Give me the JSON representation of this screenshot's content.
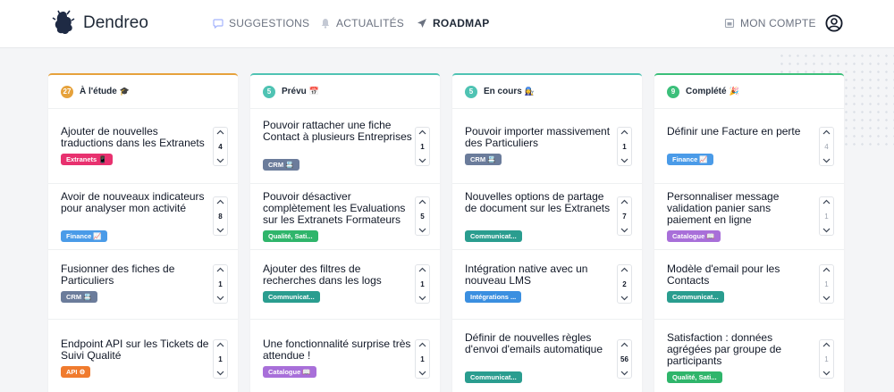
{
  "header": {
    "brand": "Dendreo",
    "nav": [
      {
        "label": "SUGGESTIONS",
        "icon": "chat-bubble-icon"
      },
      {
        "label": "ACTUALITÉS",
        "icon": "bell-icon"
      },
      {
        "label": "ROADMAP",
        "icon": "rocket-icon",
        "active": true
      }
    ],
    "account": {
      "label": "MON COMPTE",
      "icon": "account-icon"
    },
    "user_icon": "user-circle-icon"
  },
  "colors": {
    "etude": "#e6a23c",
    "prevu": "#4fc3b3",
    "encours": "#4fc3b3",
    "complete": "#3bbf7a",
    "tag_extranets": "#e8316f",
    "tag_finance": "#4a9be8",
    "tag_crm": "#6b7c9b",
    "tag_api": "#f07b2e",
    "tag_qualite": "#2fb56b",
    "tag_communication": "#2a9d8f",
    "tag_catalogue": "#a86fd9",
    "tag_integrations": "#3b8fe0"
  },
  "columns": [
    {
      "count": "27",
      "title": "À l'étude",
      "emoji": "🎓",
      "cards": [
        {
          "title": "Ajouter de nouvelles traductions dans les Extranets",
          "tag": "Extranets 📱",
          "votes": "4"
        },
        {
          "title": "Avoir de nouveaux indicateurs pour analyser mon activité",
          "tag": "Finance 📈",
          "votes": "8"
        },
        {
          "title": "Fusionner des fiches de Particuliers",
          "tag": "CRM 📇",
          "votes": "1"
        },
        {
          "title": "Endpoint API sur les Tickets de Suivi Qualité",
          "tag": "API ⚙",
          "votes": "1"
        }
      ]
    },
    {
      "count": "5",
      "title": "Prévu",
      "emoji": "📅",
      "cards": [
        {
          "title": "Pouvoir rattacher une fiche Contact à plusieurs Entreprises",
          "tag": "CRM 📇",
          "votes": "1"
        },
        {
          "title": "Pouvoir désactiver complètement les Evaluations sur les Extranets Formateurs",
          "tag": "Qualité, Sati...",
          "votes": "5"
        },
        {
          "title": "Ajouter des filtres de recherches dans les logs",
          "tag": "Communicat...",
          "votes": "1"
        },
        {
          "title": "Une fonctionnalité surprise très attendue !",
          "tag": "Catalogue 📖",
          "votes": "1"
        }
      ]
    },
    {
      "count": "5",
      "title": "En cours",
      "emoji": "👩‍🔧",
      "cards": [
        {
          "title": "Pouvoir importer massivement des Particuliers",
          "tag": "CRM 📇",
          "votes": "1"
        },
        {
          "title": "Nouvelles options de partage de document sur les Extranets",
          "tag": "Communicat...",
          "votes": "7"
        },
        {
          "title": "Intégration native avec un nouveau LMS",
          "tag": "Intégrations ...",
          "votes": "2"
        },
        {
          "title": "Définir de nouvelles règles d'envoi d'emails automatique",
          "tag": "Communicat...",
          "votes": "56"
        }
      ]
    },
    {
      "count": "9",
      "title": "Complété",
      "emoji": "🎉",
      "cards": [
        {
          "title": "Définir une Facture en perte",
          "tag": "Finance 📈",
          "votes": "4"
        },
        {
          "title": "Personnaliser message validation panier sans paiement en ligne",
          "tag": "Catalogue 📖",
          "votes": "1"
        },
        {
          "title": "Modèle d'email pour les Contacts",
          "tag": "Communicat...",
          "votes": "1"
        },
        {
          "title": "Satisfaction : données agrégées par groupe de participants",
          "tag": "Qualité, Sati...",
          "votes": "1"
        }
      ]
    }
  ]
}
